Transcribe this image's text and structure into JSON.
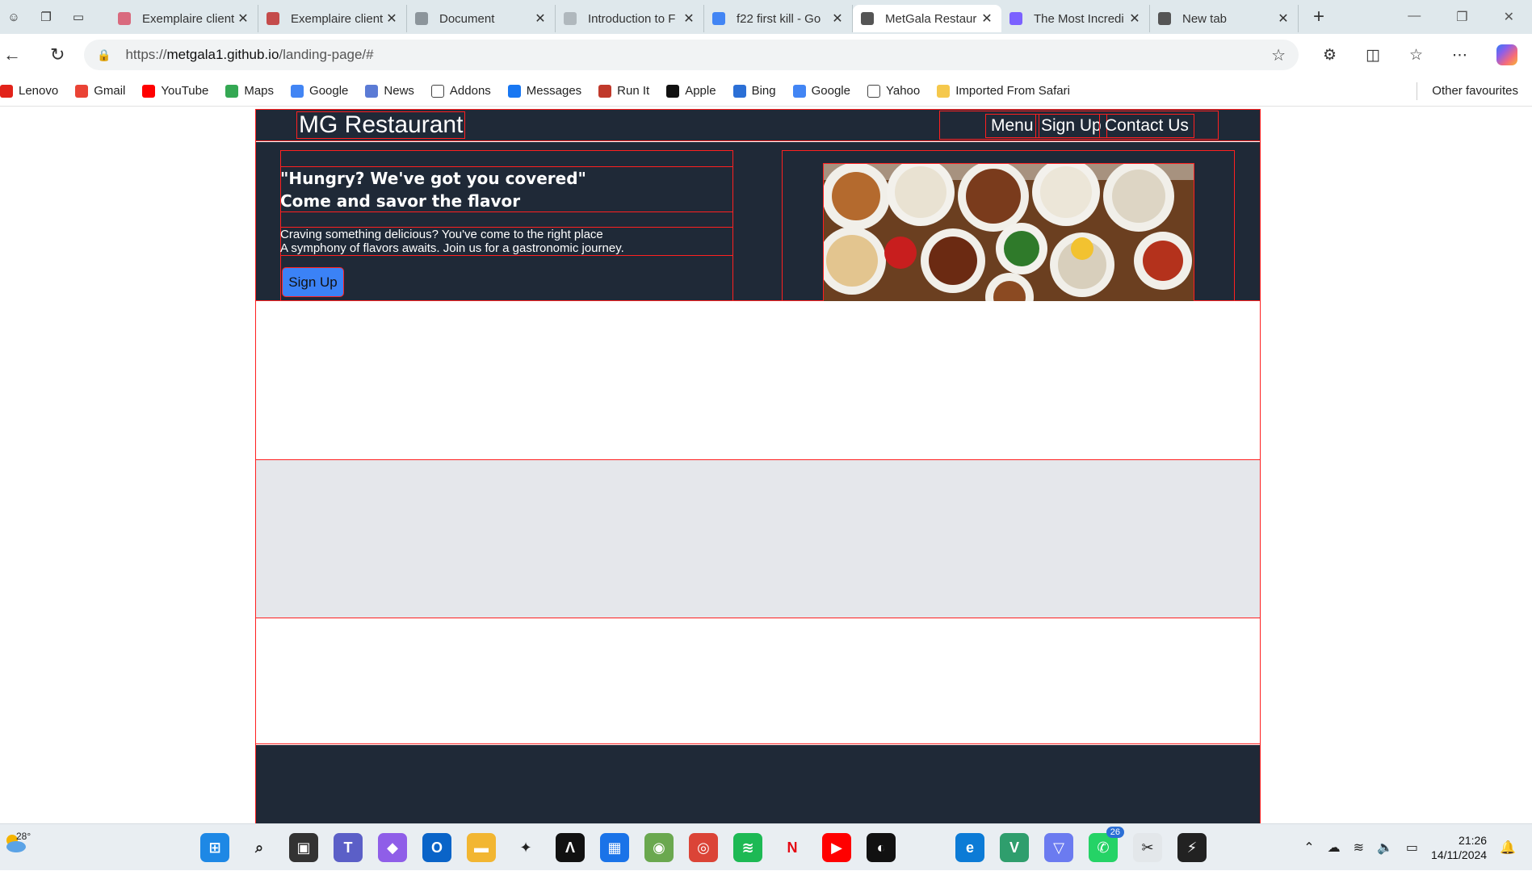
{
  "browser": {
    "tabs": [
      {
        "title": "Exemplaire client",
        "favicon_color": "#d96a7e"
      },
      {
        "title": "Exemplaire client",
        "favicon_color": "#c44b4b"
      },
      {
        "title": "Document",
        "favicon_color": "#8c959b"
      },
      {
        "title": "Introduction to F",
        "favicon_color": "#b0b8bd"
      },
      {
        "title": "f22 first kill - Go",
        "favicon_color": "#4285f4"
      },
      {
        "title": "MetGala Restaur",
        "favicon_color": "#555555"
      },
      {
        "title": "The Most Incredi",
        "favicon_color": "#7b61ff"
      },
      {
        "title": "New tab",
        "favicon_color": "#555555"
      }
    ],
    "active_tab_index": 5,
    "url_prefix": "https://",
    "url_host": "metgala1.github.io",
    "url_path": "/landing-page/#",
    "bookmarks": [
      {
        "label": "Lenovo",
        "icon": "lenovo-icon"
      },
      {
        "label": "Gmail",
        "icon": "gmail-icon"
      },
      {
        "label": "YouTube",
        "icon": "youtube-icon"
      },
      {
        "label": "Maps",
        "icon": "maps-icon"
      },
      {
        "label": "Google",
        "icon": "google-icon"
      },
      {
        "label": "News",
        "icon": "news-icon"
      },
      {
        "label": "Addons",
        "icon": "page-icon"
      },
      {
        "label": "Messages",
        "icon": "facebook-icon"
      },
      {
        "label": "Run It",
        "icon": "runit-icon"
      },
      {
        "label": "Apple",
        "icon": "apple-icon"
      },
      {
        "label": "Bing",
        "icon": "bing-search-icon"
      },
      {
        "label": "Google",
        "icon": "google-icon"
      },
      {
        "label": "Yahoo",
        "icon": "page-icon"
      },
      {
        "label": "Imported From Safari",
        "icon": "folder-icon"
      }
    ],
    "other_favourites": "Other favourites"
  },
  "site": {
    "brand": "MG Restaurant",
    "nav": [
      "Menu",
      "Sign Up",
      "Contact Us"
    ],
    "hero": {
      "heading_line1": "\"Hungry? We've got you covered\"",
      "heading_line2": "Come and savor the flavor",
      "text_line1": "Craving something delicious? You've come to the right place",
      "text_line2": "A symphony of flavors awaits. Join us for a gastronomic journey.",
      "cta": "Sign Up"
    },
    "colors": {
      "dark": "#1f2937",
      "accent": "#3b82f6",
      "debug_border": "#ff2020",
      "light_section": "#e5e7eb"
    }
  },
  "taskbar": {
    "temperature": "28°",
    "time": "21:26",
    "date": "14/11/2024",
    "whatsapp_badge": "26",
    "apps": [
      "windows-start-icon",
      "search-icon",
      "task-view-icon",
      "teams-icon",
      "copilot-icon",
      "outlook-icon",
      "file-explorer-icon",
      "gemini-icon",
      "codex-icon",
      "store-icon",
      "chameleon-icon",
      "chrome-icon",
      "spotify-icon",
      "netflix-icon",
      "youtube-icon",
      "github-icon",
      "apple-icon",
      "edge-icon",
      "vscode-icon",
      "vpn-icon",
      "whatsapp-icon",
      "snipping-tool-icon",
      "x64-icon"
    ]
  }
}
